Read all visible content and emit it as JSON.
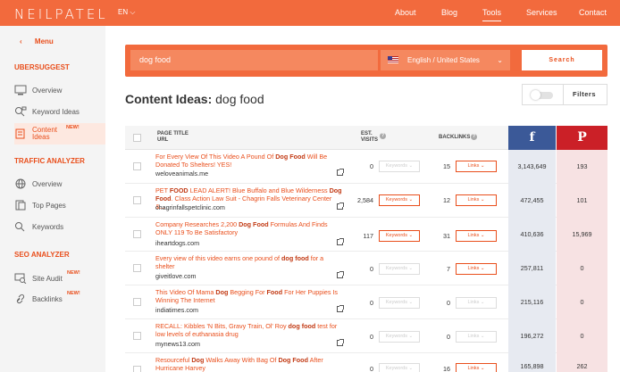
{
  "header": {
    "logo": "NEILPATEL",
    "lang": "EN ⌵",
    "nav": [
      {
        "label": "About"
      },
      {
        "label": "Blog"
      },
      {
        "label": "Tools"
      },
      {
        "label": "Services"
      },
      {
        "label": "Contact"
      }
    ]
  },
  "sidebar": {
    "menu_label": "Menu",
    "sections": [
      {
        "title": "UBERSUGGEST"
      },
      {
        "title": "TRAFFIC ANALYZER"
      },
      {
        "title": "SEO ANALYZER"
      }
    ],
    "items": [
      {
        "label": "Overview"
      },
      {
        "label": "Keyword Ideas"
      },
      {
        "label": "Content Ideas",
        "badge": "NEW!"
      },
      {
        "label": "Overview"
      },
      {
        "label": "Top Pages"
      },
      {
        "label": "Keywords"
      },
      {
        "label": "Site Audit",
        "badge": "NEW!"
      },
      {
        "label": "Backlinks",
        "badge": "NEW!"
      }
    ]
  },
  "search": {
    "query": "dog food",
    "country": "English / United States",
    "button": "Search"
  },
  "page": {
    "title_prefix": "Content Ideas:",
    "title_query": "dog food",
    "filters_label": "Filters"
  },
  "table": {
    "headers": {
      "page_title": "PAGE TITLE",
      "url": "URL",
      "est": "EST.",
      "visits": "VISITS",
      "backlinks": "BACKLINKS",
      "facebook": "f",
      "pinterest": "P"
    },
    "keywords_btn": "Keywords ⌄",
    "links_btn": "Links ⌄",
    "rows": [
      {
        "title_parts": [
          "For Every View Of This Video A Pound Of ",
          "Dog Food",
          " Will Be Donated To Shelters! YES!"
        ],
        "url": "weloveanimals.me",
        "visits": "0",
        "backlinks": "15",
        "fb": "3,143,649",
        "pin": "193",
        "kw_active": false,
        "links_active": true
      },
      {
        "title_parts": [
          "PET ",
          "FOOD",
          " LEAD ALERT! Blue Buffalo and Blue Wilderness ",
          "Dog Food",
          ". Class Action Law Suit - Chagrin Falls Veterinary Center &..."
        ],
        "url": "chagrinfallspetclinic.com",
        "visits": "2,584",
        "backlinks": "12",
        "fb": "472,455",
        "pin": "101",
        "kw_active": true,
        "links_active": true
      },
      {
        "title_parts": [
          "Company Researches 2,200 ",
          "Dog Food",
          " Formulas And Finds ONLY 119 To Be Satisfactory"
        ],
        "url": "iheartdogs.com",
        "visits": "117",
        "backlinks": "31",
        "fb": "410,636",
        "pin": "15,969",
        "kw_active": true,
        "links_active": true
      },
      {
        "title_parts": [
          "Every view of this video earns one pound of ",
          "dog food",
          " for a shelter"
        ],
        "url": "giveitlove.com",
        "visits": "0",
        "backlinks": "7",
        "fb": "257,811",
        "pin": "0",
        "kw_active": false,
        "links_active": true
      },
      {
        "title_parts": [
          "This Video Of Mama ",
          "Dog",
          " Begging For ",
          "Food",
          " For Her Puppies Is Winning The Internet"
        ],
        "url": "indiatimes.com",
        "visits": "0",
        "backlinks": "0",
        "fb": "215,116",
        "pin": "0",
        "kw_active": false,
        "links_active": false
      },
      {
        "title_parts": [
          "RECALL: Kibbles 'N Bits, Gravy Train, Ol' Roy ",
          "dog food",
          " test for low levels of euthanasia drug"
        ],
        "url": "mynews13.com",
        "visits": "0",
        "backlinks": "0",
        "fb": "196,272",
        "pin": "0",
        "kw_active": false,
        "links_active": false
      },
      {
        "title_parts": [
          "Resourceful ",
          "Dog",
          " Walks Away With Bag Of ",
          "Dog Food",
          " After Hurricane Harvey"
        ],
        "url": "",
        "visits": "0",
        "backlinks": "16",
        "fb": "165,898",
        "pin": "262",
        "kw_active": false,
        "links_active": true
      }
    ]
  }
}
